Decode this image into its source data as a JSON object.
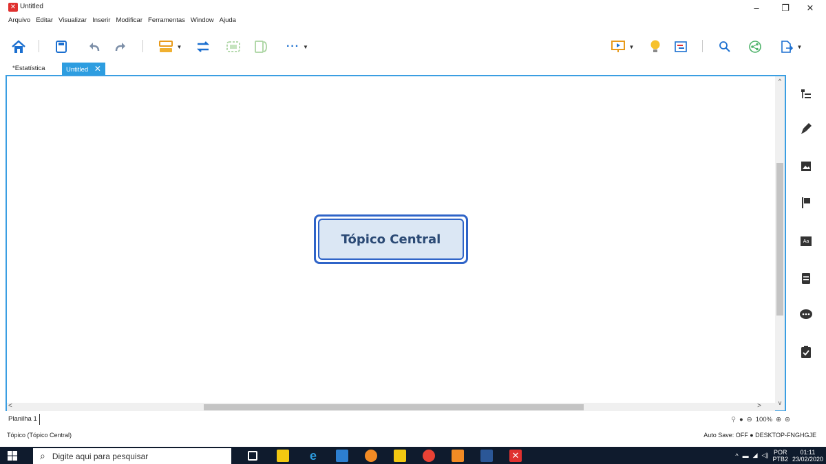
{
  "window": {
    "title": "Untitled",
    "controls": {
      "minimize": "–",
      "restore": "❐",
      "close": "✕"
    }
  },
  "menu": [
    "Arquivo",
    "Editar",
    "Visualizar",
    "Inserir",
    "Modificar",
    "Ferramentas",
    "Window",
    "Ajuda"
  ],
  "toolbar": {
    "more_label": "···",
    "icons": [
      "home-icon",
      "save-icon",
      "undo-icon",
      "redo-icon",
      "layout-icon",
      "relationship-icon",
      "boundary-icon",
      "summary-icon",
      "more-icon",
      "presentation-icon",
      "idea-icon",
      "gantt-icon",
      "search-icon",
      "share-icon",
      "export-icon"
    ]
  },
  "tabs": [
    {
      "label": "*Estatística",
      "active": false
    },
    {
      "label": "Untitled",
      "active": true,
      "close": "✕"
    }
  ],
  "canvas": {
    "central_topic": "Tópico Central"
  },
  "sidebar": {
    "icons": [
      "outline-icon",
      "format-icon",
      "image-icon",
      "marker-icon",
      "text-style-icon",
      "notes-icon",
      "comments-icon",
      "task-icon"
    ]
  },
  "sheet": {
    "name": "Planilha 1",
    "zoom": "100%"
  },
  "status": {
    "left": "Tópico (Tópico Central)",
    "right": "Auto Save: OFF  ● DESKTOP-FNGHGJE"
  },
  "taskbar": {
    "search_placeholder": "Digite aqui para pesquisar",
    "language_top": "POR",
    "language_bottom": "PTB2",
    "time": "01:11",
    "date": "23/02/2020",
    "colors": {
      "background": "#0f1b2d",
      "accent": "#2d9de0"
    }
  }
}
